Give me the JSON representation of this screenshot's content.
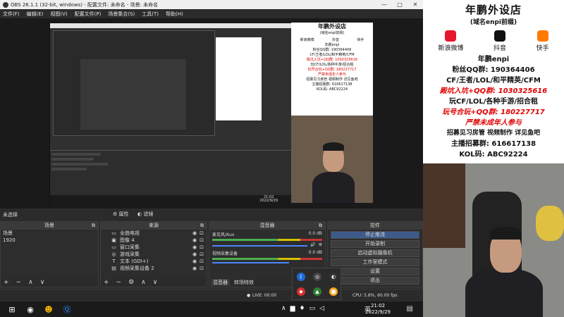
{
  "window": {
    "title": "OBS 26.1.1 (32-bit, windows) - 配置文件: 未命名 - 场景: 未命名",
    "controls": [
      "—",
      "□",
      "✕"
    ]
  },
  "menu": [
    "文件(F)",
    "编辑(E)",
    "视图(V)",
    "配置文件(P)",
    "场景集合(S)",
    "工具(T)",
    "帮助(H)"
  ],
  "poster": {
    "title": "年鹏外设店",
    "subtitle": "(域名enpi前缀)",
    "socials": [
      {
        "label": "新浪微博",
        "icon": "weibo-icon",
        "color": "#e6162d"
      },
      {
        "label": "抖音",
        "icon": "douyin-icon",
        "color": "#111111"
      },
      {
        "label": "快手",
        "icon": "kuaishou-icon",
        "color": "#ff7a00"
      }
    ],
    "handle": "年鹏enpi",
    "lines": [
      "粉丝QQ群: 190364406",
      "CF/王者/LOL/和平精英/CFM",
      "殿坑入坑+QQ群: 1030325616",
      "玩CF/LOL/各种手游/招合租",
      "玩号合玩+QQ群: 180227717",
      "严禁未成年人参与",
      "招募见习房管 视频制作 详见鱼吧",
      "主播招募群: 616617138",
      "KOL码: ABC92224"
    ]
  },
  "nested_status": "未选择",
  "docks": {
    "scenes": {
      "title": "场景",
      "items": [
        "场景",
        "1920"
      ],
      "selected": 1
    },
    "sources": {
      "title": "来源",
      "items": [
        {
          "icon": "▭",
          "label": "全曲电视"
        },
        {
          "icon": "▣",
          "label": "图像 4"
        },
        {
          "icon": "▭",
          "label": "窗口采集"
        },
        {
          "icon": "◎",
          "label": "游戏采集"
        },
        {
          "icon": "T",
          "label": "文本 (GDI+)"
        },
        {
          "icon": "▤",
          "label": "视频采集设备 2"
        }
      ]
    },
    "mixer": {
      "title": "混音器",
      "channels": [
        {
          "name": "麦克风/Aux",
          "db": "0.0 dB"
        },
        {
          "name": "视频采集设备",
          "db": "0.0 dB"
        }
      ],
      "tabs": [
        "混音器",
        "转场特效"
      ]
    },
    "controls": {
      "title": "控件",
      "buttons": [
        "停止推流",
        "开始录制",
        "启动虚拟摄像机",
        "工作室模式",
        "设置",
        "退出"
      ]
    }
  },
  "scene_filter_labels": [
    "属性",
    "滤镜"
  ],
  "status": {
    "live": "LIVE: 00:00",
    "cpu": "CPU: 5.8%, 60.00 fps"
  },
  "taskbar": {
    "time": "21:02",
    "date": "2022/9/29",
    "ime": "英"
  },
  "nested_clock": {
    "time": "21:02",
    "date": "2022/9/29"
  }
}
